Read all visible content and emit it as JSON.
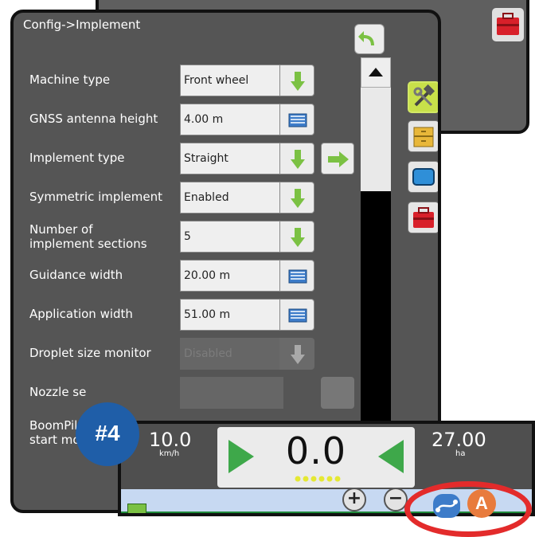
{
  "panel": {
    "title": "Config->Implement"
  },
  "rows": [
    {
      "label": "Machine type",
      "value": "Front wheel",
      "control": "dropdown"
    },
    {
      "label": "GNSS antenna height",
      "value": "4.00 m",
      "control": "keyboard"
    },
    {
      "label": "Implement type",
      "value": "Straight",
      "control": "dropdown"
    },
    {
      "label": "Symmetric implement",
      "value": "Enabled",
      "control": "dropdown"
    },
    {
      "label": "Number of",
      "label2": "implement sections",
      "value": "5",
      "control": "dropdown"
    },
    {
      "label": "Guidance width",
      "value": "20.00 m",
      "control": "keyboard"
    },
    {
      "label": "Application width",
      "value": "51.00 m",
      "control": "keyboard"
    },
    {
      "label": "Droplet size monitor",
      "value": "Disabled",
      "control": "dropdown"
    },
    {
      "label": "Nozzle se"
    },
    {
      "label": "BoomPilot",
      "label2": "start mode"
    }
  ],
  "guidance": {
    "speed": "10.0",
    "speed_unit": "km/h",
    "cross_track": "0.0",
    "area": "27.00",
    "area_unit": "ha"
  },
  "callout": {
    "label": "#4"
  },
  "controls": {
    "zoom_in": "+",
    "zoom_out": "−",
    "auto_label": "A"
  },
  "colors": {
    "accent_green": "#7bc143",
    "highlight_red": "#e32b2b",
    "badge_blue": "#1f5ea8"
  }
}
